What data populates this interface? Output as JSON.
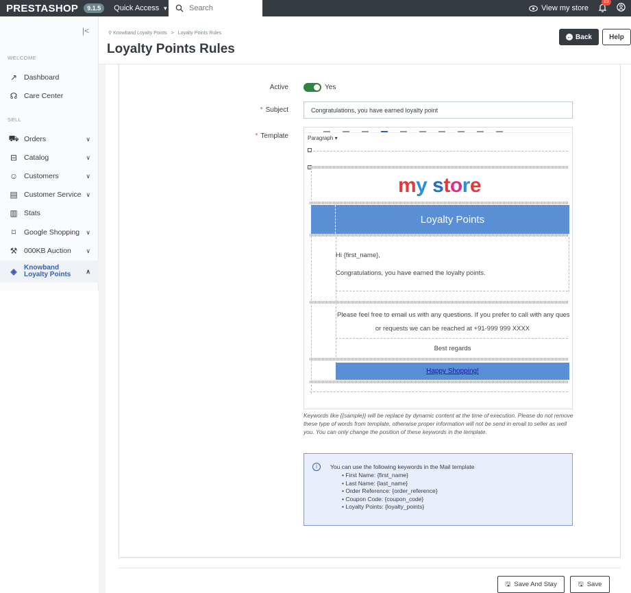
{
  "topbar": {
    "logo": "PRESTASHOP",
    "version": "9.1.5",
    "quick_access": "Quick Access",
    "search_placeholder": "Search",
    "view_store": "View my store",
    "notif_count": "19"
  },
  "sidebar": {
    "section_welcome": "WELCOME",
    "section_sell": "SELL",
    "items": [
      {
        "label": "Dashboard",
        "icon": "trend-icon"
      },
      {
        "label": "Care Center",
        "icon": "headset-icon"
      },
      {
        "label": "Orders",
        "icon": "cart-icon"
      },
      {
        "label": "Catalog",
        "icon": "store-icon"
      },
      {
        "label": "Customers",
        "icon": "user-icon"
      },
      {
        "label": "Customer Service",
        "icon": "chat-icon"
      },
      {
        "label": "Stats",
        "icon": "chart-icon"
      },
      {
        "label": "Google Shopping",
        "icon": "bag-icon"
      },
      {
        "label": "000KB Auction",
        "icon": "gavel-icon"
      },
      {
        "label": "Knowband Loyalty Points",
        "icon": "tag-icon"
      }
    ]
  },
  "header": {
    "breadcrumb_1": "Knowband Loyalty Points",
    "breadcrumb_sep": ">",
    "breadcrumb_2": "Loyalty Points Rules",
    "title": "Loyalty Points Rules",
    "back": "Back",
    "help": "Help"
  },
  "form": {
    "active_label": "Active",
    "active_value": "Yes",
    "subject_label": "Subject",
    "subject_value": "Congratulations, you have earned loyalty point",
    "template_label": "Template",
    "paragraph": "Paragraph",
    "template": {
      "logo_text": "my store",
      "banner": "Loyalty Points",
      "greeting": "Hi {first_name},",
      "body": "Congratulations, you have earned the loyalty points.",
      "contact_1": "Please feel free to email us with any questions. If you prefer to call with any ques",
      "contact_2": "or requests we can be reached at +91-999 999 XXXX",
      "regards": "Best regards",
      "footer_link": "Happy Shopping!"
    },
    "note": "Keywords like {{sample}} will be replace by dynamic content at the time of execution. Please do not remove these type of words from template, otherwise proper information will not be send in email to seller as well you. You can only change the position of these keywords in the template.",
    "info_title": "You can use the following keywords in the Mail template",
    "keywords": [
      "First Name: {first_name}",
      "Last Name: {last_name}",
      "Order Reference: {order_reference}",
      "Coupon Code: {coupon_code}",
      "Loyalty Points: {loyalty_points}"
    ]
  },
  "footer": {
    "save_stay": "Save And Stay",
    "save": "Save"
  },
  "colors": {
    "topbar": "#363a41",
    "accent": "#3b5cb3",
    "toggle": "#2e8540",
    "banner": "#5a8fd6"
  }
}
